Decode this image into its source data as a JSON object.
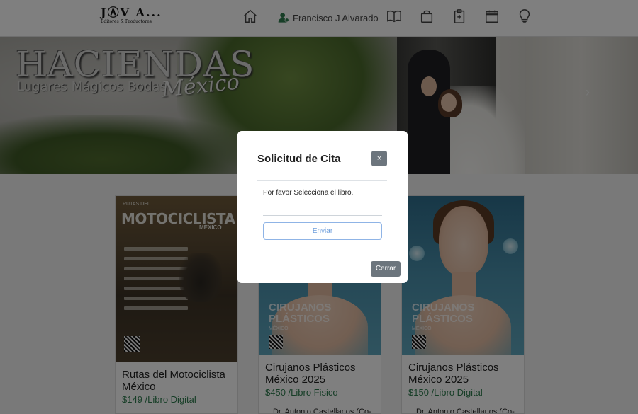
{
  "navbar": {
    "logo_line1": "JⒶV A...",
    "logo_line2": "Editores & Productores",
    "user_name": "Francisco J Alvarado",
    "icons": [
      "home-icon",
      "user-icon",
      "book-icon",
      "bag-icon",
      "clipboard-icon",
      "calendar-icon",
      "lightbulb-icon"
    ]
  },
  "hero": {
    "title": "HACIENDAS",
    "subtitle": "Lugares Mágicos Bodas",
    "script": "México",
    "arrow": "›"
  },
  "cards": [
    {
      "cover_title": "MOTOCICLISTA",
      "cover_small": "RUTAS DEL",
      "cover_country": "MÉXICO",
      "title": "Rutas del Motociclista México",
      "price": "$149 /Libro Digital",
      "author": ""
    },
    {
      "cover_title": "CIRUJANOS PLÁSTICOS",
      "cover_country": "MÉXICO",
      "title": "Cirujanos Plásticos México 2025",
      "price": "$450 /Libro Fisico",
      "author": "Dr. Antonio Castellanos (Co-"
    },
    {
      "cover_title": "CIRUJANOS PLÁSTICOS",
      "cover_country": "MÉXICO",
      "title": "Cirujanos Plásticos México 2025",
      "price": "$150 /Libro Digital",
      "author": "Dr. Antonio Castellanos (Co-"
    }
  ],
  "modal": {
    "title": "Solicitud de Cita",
    "close_x": "×",
    "label": "Por favor Selecciona el libro.",
    "select_value": "",
    "send_label": "Enviar",
    "close_label": "Cerrar"
  },
  "colors": {
    "price_green": "#2e7d4f",
    "user_green": "#2e7d4f",
    "modal_button_gray": "#6c757d",
    "send_blue": "#6f9fdc"
  }
}
